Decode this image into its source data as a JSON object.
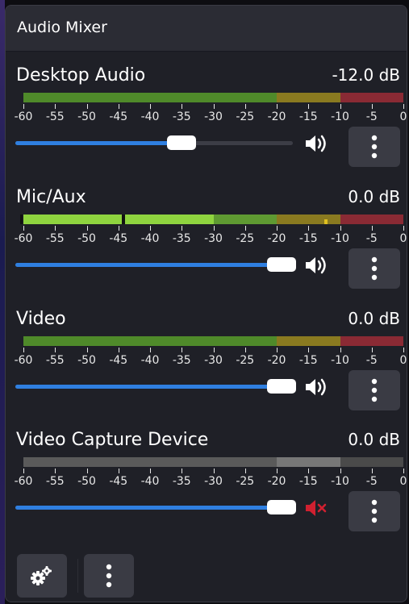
{
  "panel": {
    "title": "Audio Mixer"
  },
  "scale_labels": [
    "-60",
    "-55",
    "-50",
    "-45",
    "-40",
    "-35",
    "-30",
    "-25",
    "-20",
    "-15",
    "-10",
    "-5",
    "0"
  ],
  "channels": [
    {
      "name": "Desktop Audio",
      "db": "-12.0 dB",
      "volume_fraction": 0.6,
      "muted": false,
      "meter_active": false
    },
    {
      "name": "Mic/Aux",
      "db": "0.0 dB",
      "volume_fraction": 0.96,
      "muted": false,
      "meter_active": true
    },
    {
      "name": "Video",
      "db": "0.0 dB",
      "volume_fraction": 0.96,
      "muted": false,
      "meter_active": false
    },
    {
      "name": "Video Capture Device",
      "db": "0.0 dB",
      "volume_fraction": 0.96,
      "muted": true,
      "meter_active": false
    }
  ],
  "icons": {
    "volume": "speaker-volume-icon",
    "muted": "speaker-muted-icon",
    "menu": "vertical-dots-icon",
    "settings": "gears-icon"
  },
  "colors": {
    "accent": "#2f7fe0",
    "meter_green": "#4f8a2a",
    "meter_green_active": "#8fd43f",
    "meter_yellow": "#8a7a20",
    "meter_red": "#8a2a34",
    "muted_red": "#d02030",
    "muted_gray": "#6a6a6a"
  }
}
